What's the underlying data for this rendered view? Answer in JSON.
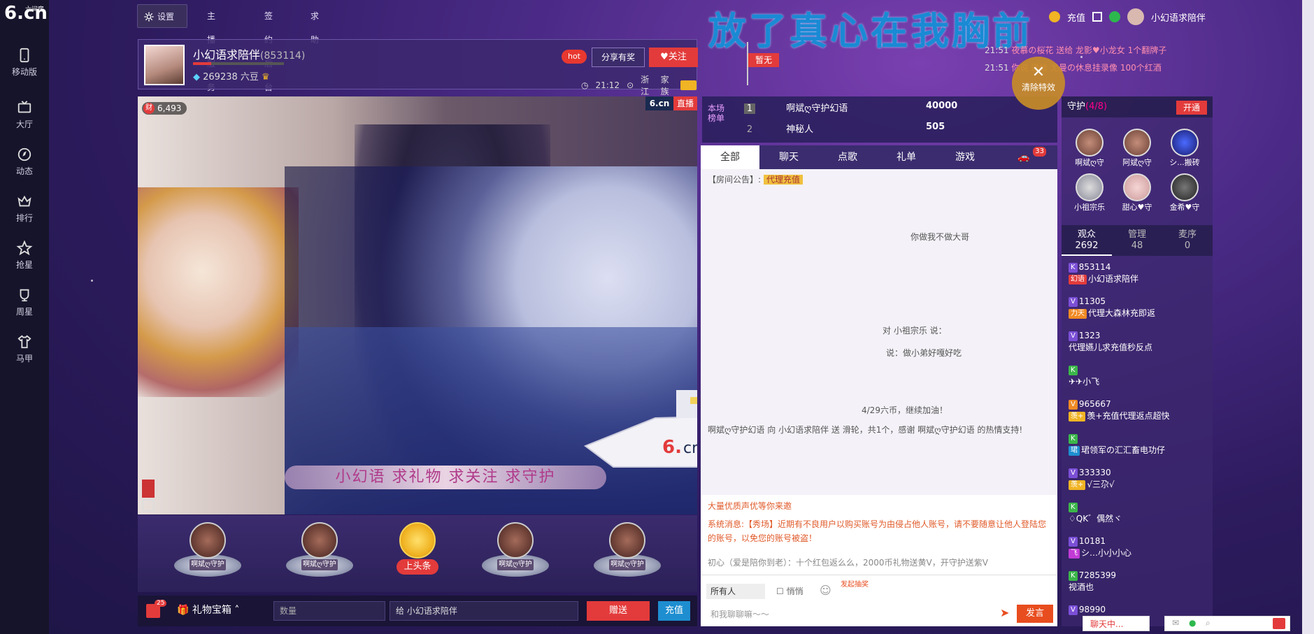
{
  "colors": {
    "accent": "#e33b3b",
    "blue": "#1e8ed0",
    "banner": "#1a8ad4"
  },
  "sidebar": {
    "items": [
      {
        "label": "移动版",
        "icon": "phone-icon"
      },
      {
        "label": "大厅",
        "icon": "tv-icon"
      },
      {
        "label": "动态",
        "icon": "compass-icon"
      },
      {
        "label": "排行",
        "icon": "crown-icon"
      },
      {
        "label": "抢星",
        "icon": "star-icon"
      },
      {
        "label": "周星",
        "icon": "cup-icon"
      },
      {
        "label": "马甲",
        "icon": "shirt-icon"
      }
    ]
  },
  "logo": {
    "text": "6.cn",
    "sub": "六间房"
  },
  "topbar": {
    "settings": "设置",
    "links": [
      "主播服务",
      "签约后台",
      "求助"
    ]
  },
  "banner_text": "放了真心在我胸前",
  "top_right": {
    "recharge": "充值",
    "user": "小幻语求陪伴"
  },
  "anchor": {
    "name": "小幻语求陪伴",
    "id": "(853114)",
    "coins": "269238 六豆",
    "hot": "hot",
    "share": "分享有奖",
    "follow": "关注",
    "time": "21:12",
    "location": "浙江",
    "family": "家族"
  },
  "stage": {
    "flag": "暂无"
  },
  "ticker": [
    {
      "time": "21:51",
      "text": "夜慕の桜花 送给 龙影♥小龙女 1个翻牌子"
    },
    {
      "time": "21:51",
      "text": "你说 送给 尤曼の休息挂录像 100个红酒"
    }
  ],
  "video": {
    "wealth": "6,493",
    "brand": "6.cn",
    "live": "直播",
    "wealth_badge": "财"
  },
  "slogan": "小幻语 求礼物 求关注 求守护",
  "gifts": [
    {
      "label": "啊斌ღ守护"
    },
    {
      "label": "啊斌ღ守护"
    },
    {
      "label": "上头条"
    },
    {
      "label": "啊斌ღ守护"
    },
    {
      "label": "啊斌ღ守护"
    }
  ],
  "bottom": {
    "gift_box": "礼物宝箱",
    "quantity_placeholder": "数量",
    "to": "给",
    "recipient": "小幻语求陪伴",
    "give": "赠送",
    "recharge": "充值",
    "wealth_count": "25"
  },
  "rank": {
    "title": "本场榜单",
    "rows": [
      {
        "rank": "1",
        "name": "啊斌ღ守护幻语",
        "score": "40000"
      },
      {
        "rank": "2",
        "name": "神秘人",
        "score": "505"
      }
    ]
  },
  "clear_fx": "清除特效",
  "chat": {
    "tabs": [
      "全部",
      "聊天",
      "点歌",
      "礼单",
      "游戏"
    ],
    "car_count": "33",
    "notice_label": "【房间公告】:",
    "notice_tag": "代理充值",
    "messages": [
      "你做我不做大哥",
      "对 小祖宗乐 说：",
      "说：做小弟好嘎好吃",
      "4/29六币，继续加油！",
      "啊斌ღ守护幻语 向 小幻语求陪伴 送 滑轮，共1个，感谢 啊斌ღ守护幻语 的热情支持!"
    ],
    "sys": [
      "大量优质声优等你来邀",
      "系统消息:【秀场】近期有不良用户以购买账号为由侵占他人账号，请不要随意让他人登陆您的账号，以免您的账号被盗！",
      "初心（爱是陪你到老）：十个红包返么么，2000币礼物送黄V，开守护送紫V"
    ],
    "audience": "所有人",
    "whisper": "悄悄",
    "lottery": "发起抽奖",
    "input_placeholder": "和我聊聊嘛～～",
    "send": "发言"
  },
  "guard": {
    "title": "守护",
    "count": "(4/8)",
    "open": "开通",
    "members": [
      "啊斌ღ守",
      "阿斌ღ守",
      "シ...搬砖",
      "小祖宗乐",
      "甜心♥守",
      "金希♥守"
    ]
  },
  "audience_tabs": [
    {
      "label": "观众",
      "count": "2692"
    },
    {
      "label": "管理",
      "count": "48"
    },
    {
      "label": "麦序",
      "count": "0"
    }
  ],
  "viewers": [
    {
      "id": "853114",
      "tag": "幻语",
      "name": "小幻语求陪伴"
    },
    {
      "id": "11305",
      "tag": "力天",
      "name": "代理大森林充即返"
    },
    {
      "id": "1323",
      "tag": "",
      "name": "代理嬿儿求充值秒反点"
    },
    {
      "id": "",
      "tag": "",
      "name": "✈✈小飞"
    },
    {
      "id": "965667",
      "tag": "羡+",
      "name": "羡+充值代理返点超快"
    },
    {
      "id": "",
      "tag": "珺",
      "name": "珺领军の汇汇畜电功仔"
    },
    {
      "id": "333330",
      "tag": "羡+",
      "name": "√三尕√"
    },
    {
      "id": "",
      "tag": "",
      "name": "♢QK゛偶然ヾ"
    },
    {
      "id": "10181",
      "tag": "飞",
      "name": "シ…小小小心"
    },
    {
      "id": "7285399",
      "tag": "",
      "name": "视酒也"
    },
    {
      "id": "98990",
      "tag": "",
      "name": ""
    }
  ],
  "chatting": "聊天中..."
}
